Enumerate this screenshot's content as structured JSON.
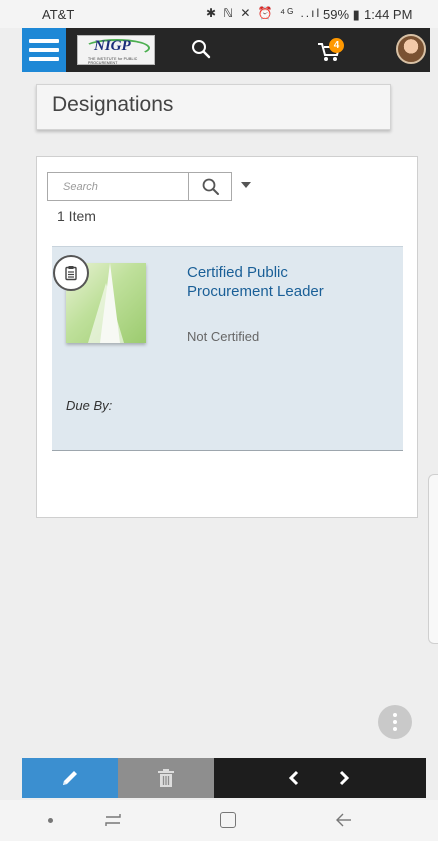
{
  "status_bar": {
    "carrier": "AT&T",
    "icons": "✱ ℕ ✕ ⏰ ⁴ᴳ ..ıl",
    "battery": "59% ▮",
    "time": "1:44 PM"
  },
  "header": {
    "logo_text": "NIGP",
    "logo_subtext": "THE INSTITUTE for PUBLIC PROCUREMENT",
    "cart_count": "4"
  },
  "page": {
    "title": "Designations"
  },
  "list": {
    "search_placeholder": "Search",
    "item_count": "1 Item",
    "items": [
      {
        "title": "Certified Public Procurement Leader",
        "status": "Not Certified",
        "due_label": "Due By:"
      }
    ]
  },
  "colors": {
    "menu_blue": "#1e88d6",
    "header_dark": "#262626",
    "item_bg": "#dfe8ef",
    "link_blue": "#1a5f97",
    "cart_badge": "#ff9800"
  }
}
